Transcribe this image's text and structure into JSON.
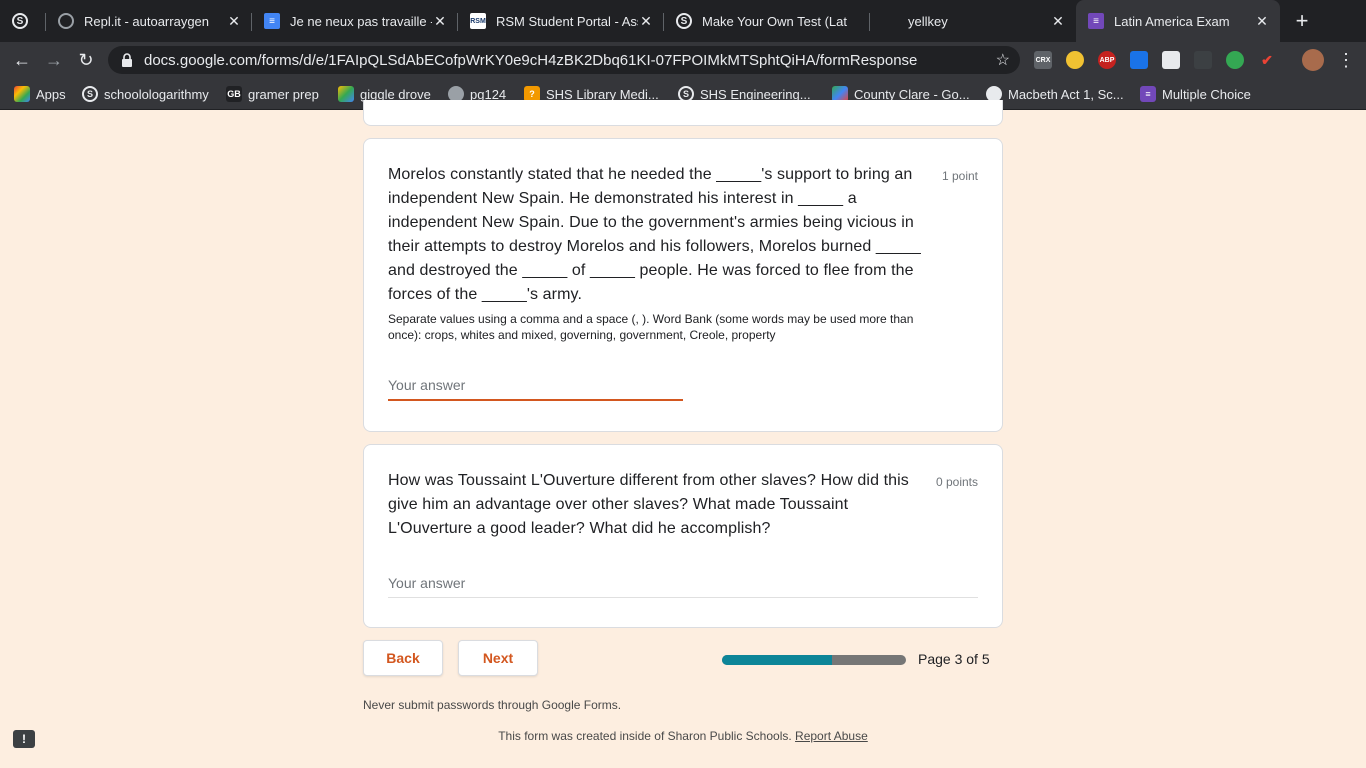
{
  "browser": {
    "tabs": [
      {
        "title": "Repl.it - autoarraygen"
      },
      {
        "title": "Je ne neux pas travaille -"
      },
      {
        "title": "RSM Student Portal - Ass"
      },
      {
        "title": "Make Your Own Test (Lat"
      },
      {
        "title": "yellkey"
      },
      {
        "title": "Latin America Exam"
      }
    ],
    "url": "docs.google.com/forms/d/e/1FAIpQLSdAbECofpWrKY0e9cH4zBK2Dbq61KI-07FPOIMkMTSphtQiHA/formResponse",
    "bookmarks": [
      {
        "label": "Apps"
      },
      {
        "label": "schoolologarithmy"
      },
      {
        "label": "gramer prep"
      },
      {
        "label": "giggle drove"
      },
      {
        "label": "pg124"
      },
      {
        "label": "SHS Library Medi..."
      },
      {
        "label": "SHS Engineering..."
      },
      {
        "label": "County Clare - Go..."
      },
      {
        "label": "Macbeth Act 1, Sc..."
      },
      {
        "label": "Multiple Choice"
      }
    ],
    "extensions": [
      "CRX",
      "ABP"
    ]
  },
  "form": {
    "questions": [
      {
        "text": "Morelos constantly stated that he needed the _____'s support to bring an independent New Spain. He demonstrated his interest in _____ a independent New Spain. Due to the government's armies being vicious in their attempts to destroy Morelos and his followers, Morelos burned _____ and destroyed the _____ of _____ people. He was forced to flee from the forces of the _____'s army.",
        "points": "1 point",
        "help": "Separate values using a comma and a space (, ). Word Bank (some words may be used more than once): crops, whites and mixed, governing, government, Creole, property",
        "placeholder": "Your answer"
      },
      {
        "text": "How was Toussaint L'Ouverture different from other slaves? How did this give him an advantage over other slaves? What made Toussaint L'Ouverture a good leader? What did he accomplish?",
        "points": "0 points",
        "placeholder": "Your answer"
      }
    ],
    "back_label": "Back",
    "next_label": "Next",
    "progress": 0.6,
    "page_label": "Page 3 of 5",
    "password_warning": "Never submit passwords through Google Forms.",
    "created_text": "This form was created inside of Sharon Public Schools.",
    "report_label": "Report Abuse",
    "colors": {
      "accent": "#d3571f",
      "progress": "#0d8598",
      "background": "#fdeee0"
    }
  }
}
